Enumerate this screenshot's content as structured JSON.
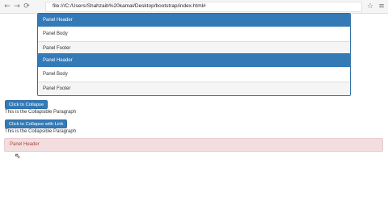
{
  "browser": {
    "back_icon": "←",
    "forward_icon": "→",
    "reload_icon": "⟳",
    "url": "file:///C:/Users/Shahzaib%20kamal/Desktop/bootstrap/index.html#",
    "star_icon": "☆",
    "menu_icon": "≡"
  },
  "panels": [
    {
      "header": "Panel Header",
      "body": "Panel Body",
      "footer": "Panel Footer"
    },
    {
      "header": "Panel Header",
      "body": "Panel Body",
      "footer": "Panel Footer"
    }
  ],
  "buttons": {
    "collapse": "Click to Collapse",
    "collapse_link": "Click to Collapse with Link"
  },
  "paragraphs": {
    "collapsible_1": "This is the Collapsible Paragraph",
    "collapsible_2": "This is the Collapsible Paragraph"
  },
  "danger_panel": {
    "header": "Panel Header"
  },
  "colors": {
    "primary": "#337ab7",
    "danger_bg": "#f2dede",
    "danger_text": "#a94442"
  }
}
